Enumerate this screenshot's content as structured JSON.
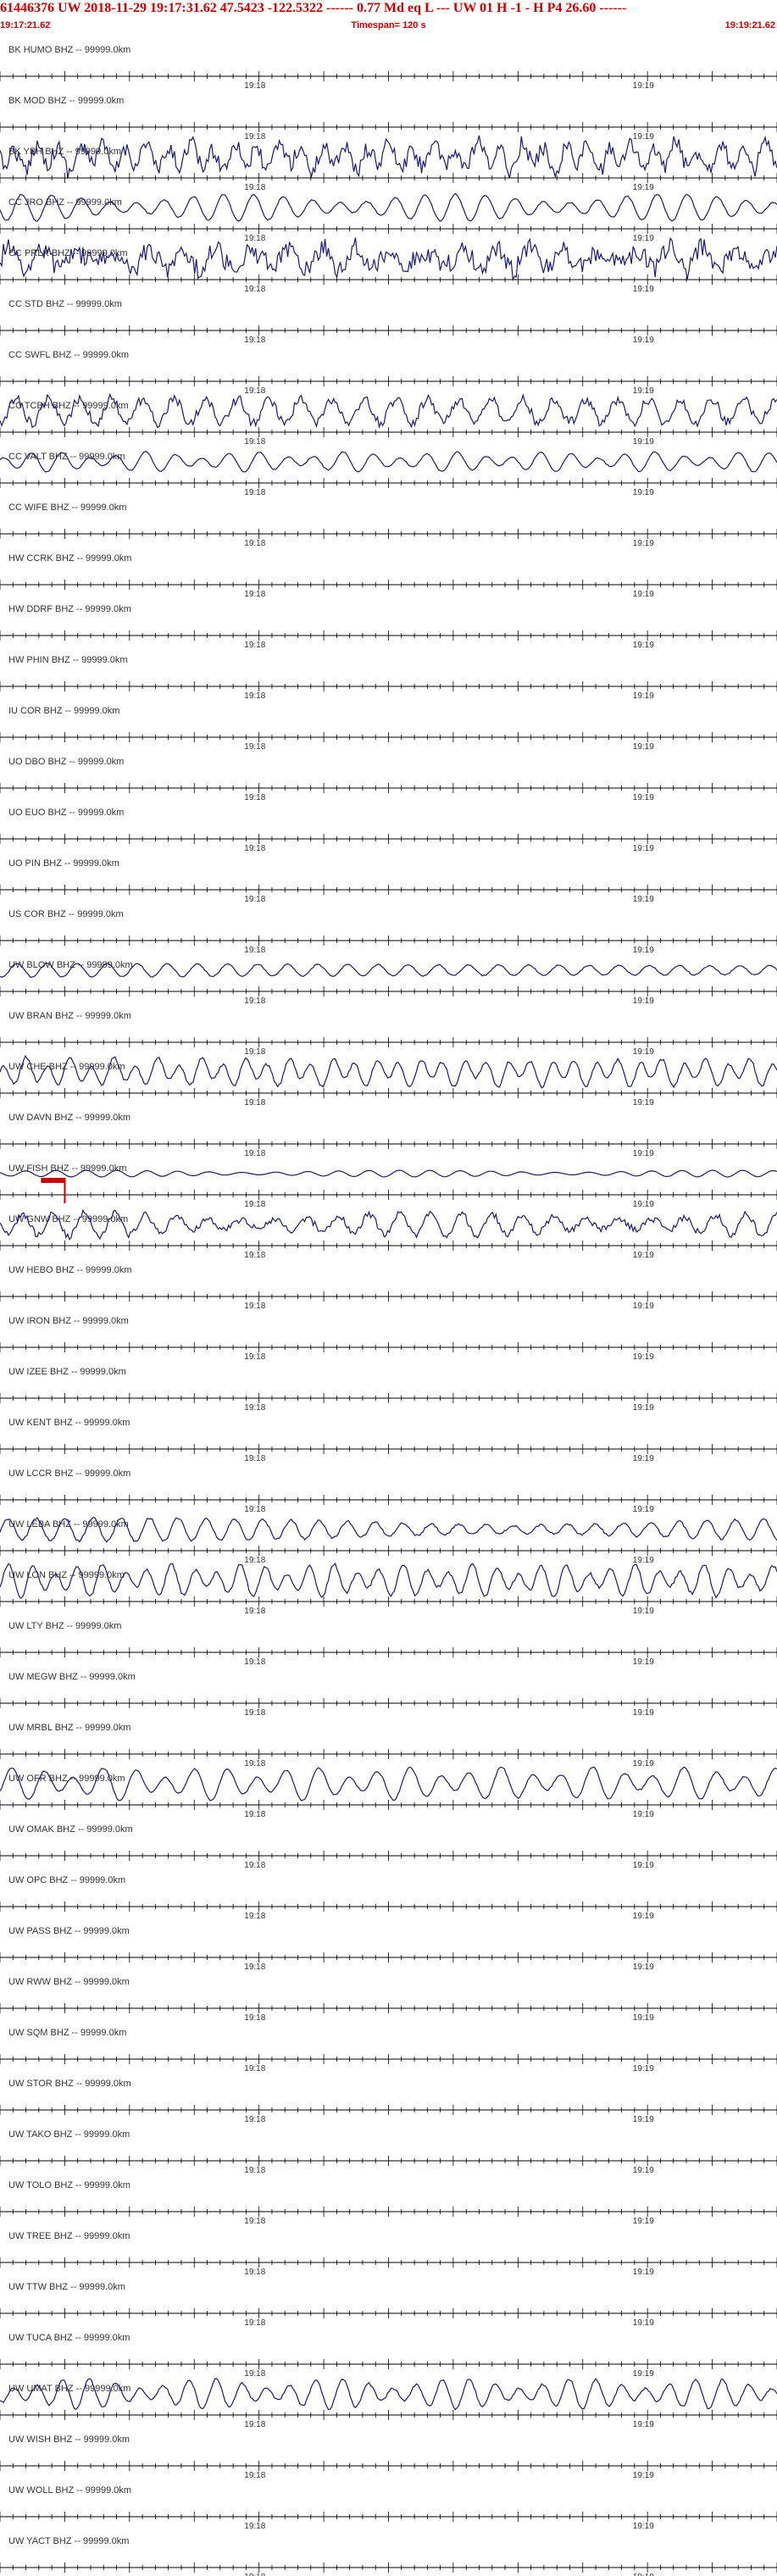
{
  "header": {
    "title": "61446376 UW 2018-11-29 19:17:31.62   47.5423 -122.5322 ------  0.77 Md  eq  L ---      UW 01  H  -1  -  H P4   26.60 ------",
    "start_time": "19:17:21.62",
    "timespan": "Timespan= 120 s",
    "end_time": "19:19:21.62"
  },
  "time_labels": [
    "19:18",
    "19:19"
  ],
  "colors": {
    "header_red": "#d10000",
    "trace": "#1a1a6e",
    "axis": "#000000",
    "marker": "#cc0000"
  },
  "chart_data": {
    "type": "line",
    "title": "61446376 UW 2018-11-29 19:17:31.62",
    "xlabel": "",
    "ylabel": "",
    "time_range": [
      "19:17:21.62",
      "19:19:21.62"
    ],
    "pick_marker_station": "UW FISH BHZ",
    "stations": [
      {
        "label": "BK HUMO BHZ -- 99999.0km",
        "amp": 0
      },
      {
        "label": "BK MOD BHZ -- 99999.0km",
        "amp": 0
      },
      {
        "label": "BK YBH BHZ -- 99999.0km",
        "amp": 0.9,
        "noise": 0.6
      },
      {
        "label": "CC JRO BHZ -- 99999.0km",
        "amp": 0.8,
        "noise": 0.05
      },
      {
        "label": "CC PRLK BHZ -- 99999.0km",
        "amp": 0.7,
        "noise": 0.9
      },
      {
        "label": "CC STD BHZ -- 99999.0km",
        "amp": 0
      },
      {
        "label": "CC SWFL BHZ -- 99999.0km",
        "amp": 0
      },
      {
        "label": "CC TCBH BHZ -- 99999.0km",
        "amp": 0.8,
        "noise": 0.4
      },
      {
        "label": "CC VALT BHZ -- 99999.0km",
        "amp": 0.6,
        "noise": 0.05
      },
      {
        "label": "CC WIFE BHZ -- 99999.0km",
        "amp": 0
      },
      {
        "label": "HW CCRK BHZ -- 99999.0km",
        "amp": 0
      },
      {
        "label": "HW DDRF BHZ -- 99999.0km",
        "amp": 0
      },
      {
        "label": "HW PHIN BHZ -- 99999.0km",
        "amp": 0
      },
      {
        "label": "IU COR BHZ -- 99999.0km",
        "amp": 0
      },
      {
        "label": "UO DBO BHZ -- 99999.0km",
        "amp": 0
      },
      {
        "label": "UO EUO BHZ -- 99999.0km",
        "amp": 0
      },
      {
        "label": "UO PIN BHZ -- 99999.0km",
        "amp": 0
      },
      {
        "label": "US COR BHZ -- 99999.0km",
        "amp": 0
      },
      {
        "label": "UW BLOW BHZ -- 99999.0km",
        "amp": 0.7,
        "noise": 0.05
      },
      {
        "label": "UW BRAN BHZ -- 99999.0km",
        "amp": 0
      },
      {
        "label": "UW CHE BHZ -- 99999.0km",
        "amp": 0.9,
        "noise": 0.1
      },
      {
        "label": "UW DAVN BHZ -- 99999.0km",
        "amp": 0
      },
      {
        "label": "UW FISH BHZ -- 99999.0km",
        "amp": 0.2,
        "noise": 0.02
      },
      {
        "label": "UW GNW BHZ -- 99999.0km",
        "amp": 0.7,
        "noise": 0.3
      },
      {
        "label": "UW HEBO BHZ -- 99999.0km",
        "amp": 0
      },
      {
        "label": "UW IRON BHZ -- 99999.0km",
        "amp": 0
      },
      {
        "label": "UW IZEE BHZ -- 99999.0km",
        "amp": 0
      },
      {
        "label": "UW KENT BHZ -- 99999.0km",
        "amp": 0
      },
      {
        "label": "UW LCCR BHZ -- 99999.0km",
        "amp": 0
      },
      {
        "label": "UW LEBA BHZ -- 99999.0km",
        "amp": 0.7,
        "noise": 0.1
      },
      {
        "label": "UW LON BHZ -- 99999.0km",
        "amp": 1.0,
        "noise": 0.1
      },
      {
        "label": "UW LTY BHZ -- 99999.0km",
        "amp": 0
      },
      {
        "label": "UW MEGW BHZ -- 99999.0km",
        "amp": 0
      },
      {
        "label": "UW MRBL BHZ -- 99999.0km",
        "amp": 0
      },
      {
        "label": "UW OFR BHZ -- 99999.0km",
        "amp": 1.0,
        "noise": 0.05
      },
      {
        "label": "UW OMAK BHZ -- 99999.0km",
        "amp": 0
      },
      {
        "label": "UW OPC BHZ -- 99999.0km",
        "amp": 0
      },
      {
        "label": "UW PASS BHZ -- 99999.0km",
        "amp": 0
      },
      {
        "label": "UW RWW BHZ -- 99999.0km",
        "amp": 0
      },
      {
        "label": "UW SQM BHZ -- 99999.0km",
        "amp": 0
      },
      {
        "label": "UW STOR BHZ -- 99999.0km",
        "amp": 0
      },
      {
        "label": "UW TAKO BHZ -- 99999.0km",
        "amp": 0
      },
      {
        "label": "UW TOLO BHZ -- 99999.0km",
        "amp": 0
      },
      {
        "label": "UW TREE BHZ -- 99999.0km",
        "amp": 0
      },
      {
        "label": "UW TTW BHZ -- 99999.0km",
        "amp": 0
      },
      {
        "label": "UW TUCA BHZ -- 99999.0km",
        "amp": 0
      },
      {
        "label": "UW UMAT BHZ -- 99999.0km",
        "amp": 0.9,
        "noise": 0.08
      },
      {
        "label": "UW WISH BHZ -- 99999.0km",
        "amp": 0
      },
      {
        "label": "UW WOLL BHZ -- 99999.0km",
        "amp": 0
      },
      {
        "label": "UW YACT BHZ -- 99999.0km",
        "amp": 0
      }
    ]
  }
}
